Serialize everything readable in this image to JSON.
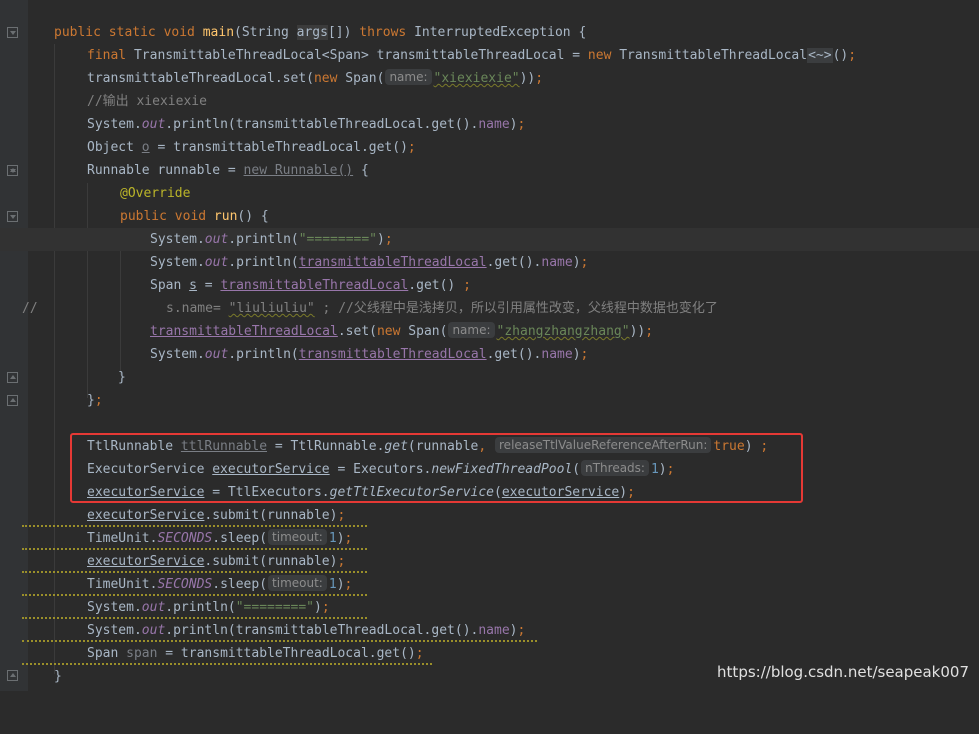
{
  "editor": {
    "lines": [
      {
        "id": "l1",
        "tokens": [
          "public",
          "static",
          "void",
          "main",
          "String",
          "args",
          "throws",
          "InterruptedException"
        ]
      },
      {
        "id": "l2"
      }
    ],
    "watermark": "https://blog.csdn.net/seapeak007",
    "hints": {
      "name1": "name:",
      "name2": "name:",
      "release": "releaseTtlValueReferenceAfterRun:",
      "nthreads": "nThreads:",
      "timeout1": "timeout:",
      "timeout2": "timeout:"
    },
    "strings": {
      "xiexiexie": "\"xiexiexie\"",
      "sep1": "\"========\"",
      "liuliuliu": "\"liuliuliu\"",
      "zhang": "\"zhangzhangzhang\"",
      "sep2": "\"========\""
    },
    "comments": {
      "output": "//输出 xiexiexie",
      "line_comment_prefix": "//",
      "chinese": "//父线程中是浅拷贝，所以引用属性改变，父线程中数据也变化了"
    }
  }
}
